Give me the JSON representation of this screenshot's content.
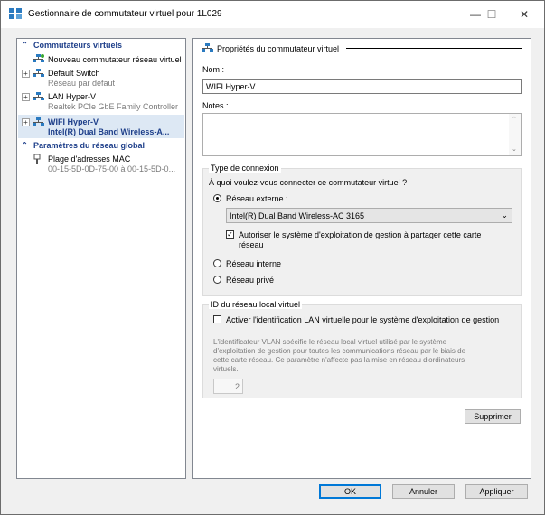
{
  "window": {
    "title": "Gestionnaire de commutateur virtuel pour 1L029",
    "minimize": "—",
    "maximize": "☐",
    "close": "✕"
  },
  "left": {
    "section1_title": "Commutateurs virtuels",
    "new_switch": "Nouveau commutateur réseau virtuel",
    "switches": [
      {
        "name": "Default Switch",
        "sub": "Réseau par défaut"
      },
      {
        "name": "LAN Hyper-V",
        "sub": "Realtek PCIe GbE Family Controller"
      },
      {
        "name": "WIFI Hyper-V",
        "sub": "Intel(R) Dual Band Wireless-A..."
      }
    ],
    "section2_title": "Paramètres du réseau global",
    "mac_range": {
      "name": "Plage d'adresses MAC",
      "sub": "00-15-5D-0D-75-00 à 00-15-5D-0..."
    }
  },
  "right": {
    "header": "Propriétés du commutateur virtuel",
    "name_label": "Nom :",
    "name_value": "WIFI Hyper-V",
    "notes_label": "Notes :",
    "conn_group": "Type de connexion",
    "conn_question": "À quoi voulez-vous connecter ce commutateur virtuel ?",
    "radio_external": "Réseau externe :",
    "adapter_selected": "Intel(R) Dual Band Wireless-AC 3165",
    "allow_os_line1": "Autoriser le système d'exploitation de gestion à partager cette carte",
    "allow_os_line2": "réseau",
    "radio_internal": "Réseau interne",
    "radio_private": "Réseau privé",
    "vlan_group": "ID du réseau local virtuel",
    "vlan_check": "Activer l'identification LAN virtuelle pour le système d'exploitation de gestion",
    "vlan_desc": [
      "L'identificateur VLAN spécifie le réseau local virtuel utilisé par le système",
      "d'exploitation de gestion pour toutes les communications réseau par le biais de",
      "cette carte réseau. Ce paramètre n'affecte pas la mise en réseau d'ordinateurs",
      "virtuels."
    ],
    "vlan_value": "2",
    "remove_button": "Supprimer"
  },
  "footer": {
    "ok": "OK",
    "cancel": "Annuler",
    "apply": "Appliquer"
  },
  "colors": {
    "accent": "#0078d7",
    "section_text": "#1e3f8a",
    "selection_bg": "#dde8f4",
    "network_icon": "#2a7ac0"
  }
}
